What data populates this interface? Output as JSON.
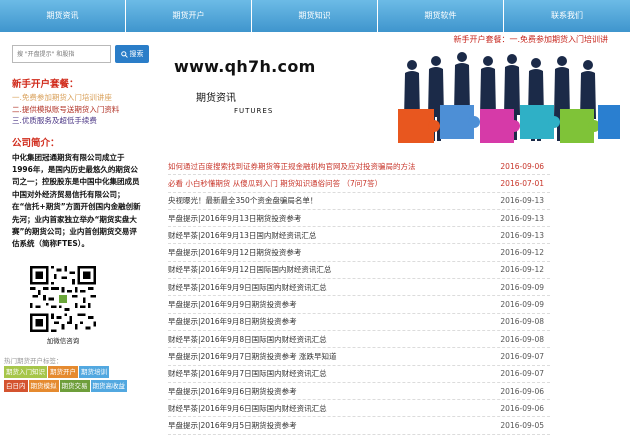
{
  "nav": [
    {
      "label": "期货资讯"
    },
    {
      "label": "期货开户"
    },
    {
      "label": "期货知识"
    },
    {
      "label": "期货软件"
    },
    {
      "label": "联系我们"
    }
  ],
  "search": {
    "placeholder": "搜 \"开盘提示\" 和股指",
    "button_label": "搜索"
  },
  "offers": {
    "title": "新手开户套餐：",
    "items": [
      "一.免费参加期货入门培训讲座",
      "二.提供模拟账号送期货入门资料",
      "三.优质服务及超低手续费"
    ]
  },
  "intro": {
    "title": "公司简介：",
    "text": "中化集团冠通期货有限公司成立于1996年，是国内历史最悠久的期货公司之一；控股股东是中国中化集团成员中国对外经济贸易信托有限公司；在“信托+期货”方面开创国内金融创新先河；业内首家独立举办“期货实盘大赛”的期货公司；业内首创期货交易评估系统（简称FTES）。"
  },
  "qr": {
    "caption": "加微信咨询"
  },
  "hot": {
    "title": "热门期货开户标签：",
    "tags": [
      "期货入门知识",
      "期货开户",
      "期货培训",
      "白日内",
      "期货模拟",
      "期货交易",
      "期货高收益"
    ]
  },
  "promo_text": "新手开户套餐：一.免费参加期货入门培训讲",
  "banner": {
    "url": "www.qh7h.com",
    "title_cn": "期货资讯",
    "title_en": "FUTURES"
  },
  "news": [
    {
      "title": "如何通过百度搜索找到证券期货等正规金融机构官网及应对投资骗局的方法",
      "date": "2016-09-06",
      "highlight": true
    },
    {
      "title": "必看 小白秒懂期货 从傻瓜到入门 期货知识通俗问答 （7问7答）",
      "date": "2016-07-01",
      "highlight": true
    },
    {
      "title": "央视曝光！最新最全350个资金盘骗局名单！",
      "date": "2016-09-13",
      "highlight": false
    },
    {
      "title": "早盘提示|2016年9月13日期货投资参考",
      "date": "2016-09-13",
      "highlight": false
    },
    {
      "title": "财经早茶|2016年9月13日国内财经资讯汇总",
      "date": "2016-09-13",
      "highlight": false
    },
    {
      "title": "早盘提示|2016年9月12日期货投资参考",
      "date": "2016-09-12",
      "highlight": false
    },
    {
      "title": "财经早茶|2016年9月12日国际国内财经资讯汇总",
      "date": "2016-09-12",
      "highlight": false
    },
    {
      "title": "财经早茶|2016年9月9日国际国内财经资讯汇总",
      "date": "2016-09-09",
      "highlight": false
    },
    {
      "title": "早盘提示|2016年9月9日期货投资参考",
      "date": "2016-09-09",
      "highlight": false
    },
    {
      "title": "早盘提示|2016年9月8日期货投资参考",
      "date": "2016-09-08",
      "highlight": false
    },
    {
      "title": "财经早茶|2016年9月8日国际国内财经资讯汇总",
      "date": "2016-09-08",
      "highlight": false
    },
    {
      "title": "早盘提示|2016年9月7日期货投资参考 涨跌早知道",
      "date": "2016-09-07",
      "highlight": false
    },
    {
      "title": "财经早茶|2016年9月7日国际国内财经资讯汇总",
      "date": "2016-09-07",
      "highlight": false
    },
    {
      "title": "早盘提示|2016年9月6日期货投资参考",
      "date": "2016-09-06",
      "highlight": false
    },
    {
      "title": "财经早茶|2016年9月6日国际国内财经资讯汇总",
      "date": "2016-09-06",
      "highlight": false
    },
    {
      "title": "早盘提示|2016年9月5日期货投资参考",
      "date": "2016-09-05",
      "highlight": false
    }
  ],
  "colors": {
    "nav_bg": "#5aaedb",
    "accent_red": "#c8362b",
    "search_btn": "#2a7dc8"
  }
}
